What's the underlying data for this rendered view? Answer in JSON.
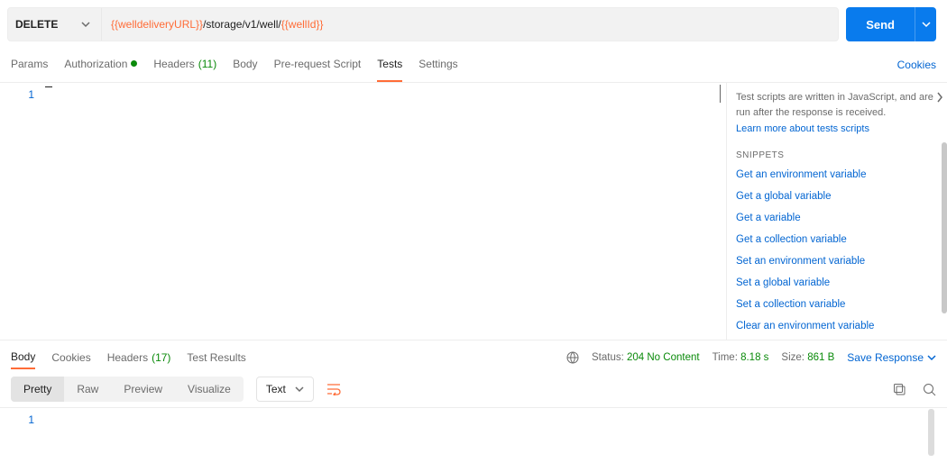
{
  "request": {
    "method": "DELETE",
    "url_parts": {
      "var1": "{{welldeliveryURL}}",
      "path": "/storage/v1/well/",
      "var2": "{{wellId}}"
    },
    "send_label": "Send"
  },
  "tabs": {
    "params": "Params",
    "authorization": "Authorization",
    "headers": "Headers",
    "headers_count": "(11)",
    "body": "Body",
    "prerequest": "Pre-request Script",
    "tests": "Tests",
    "settings": "Settings",
    "cookies_link": "Cookies"
  },
  "editor": {
    "line1": "1"
  },
  "snippets": {
    "intro": "Test scripts are written in JavaScript, and are run after the response is received.",
    "learn": "Learn more about tests scripts",
    "title": "SNIPPETS",
    "items": [
      "Get an environment variable",
      "Get a global variable",
      "Get a variable",
      "Get a collection variable",
      "Set an environment variable",
      "Set a global variable",
      "Set a collection variable",
      "Clear an environment variable"
    ]
  },
  "response_tabs": {
    "body": "Body",
    "cookies": "Cookies",
    "headers": "Headers",
    "headers_count": "(17)",
    "test_results": "Test Results"
  },
  "response_meta": {
    "status_label": "Status:",
    "status_value": "204 No Content",
    "time_label": "Time:",
    "time_value": "8.18 s",
    "size_label": "Size:",
    "size_value": "861 B",
    "save": "Save Response"
  },
  "response_toolbar": {
    "pretty": "Pretty",
    "raw": "Raw",
    "preview": "Preview",
    "visualize": "Visualize",
    "content_type": "Text"
  },
  "response_body": {
    "line1": "1"
  }
}
